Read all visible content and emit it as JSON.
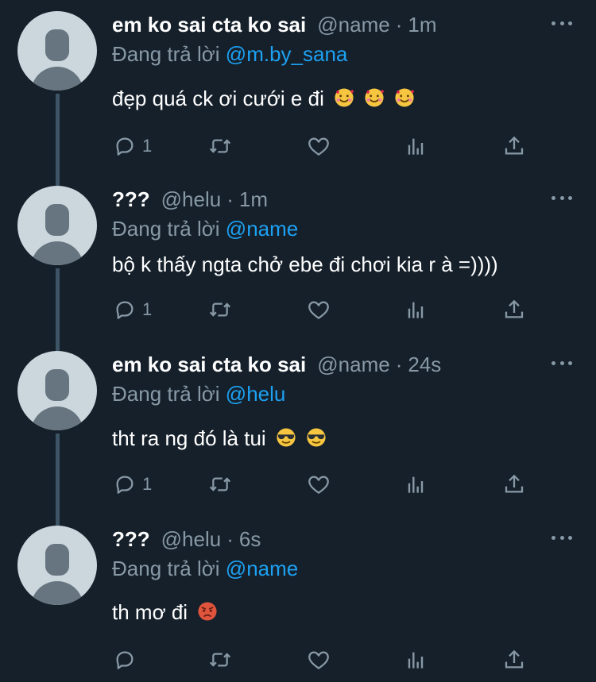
{
  "tweets": [
    {
      "name": "em ko sai cta ko sai",
      "handle": "@name",
      "time": "1m",
      "replying_prefix": "Đang trả lời",
      "replying_to": "@m.by_sana",
      "text": "đẹp quá ck ơi cưới e đi",
      "emojis": [
        "smiling-face-with-hearts",
        "smiling-face-with-hearts",
        "smiling-face-with-hearts"
      ],
      "reply_count": "1"
    },
    {
      "name": "???",
      "handle": "@helu",
      "time": "1m",
      "replying_prefix": "Đang trả lời",
      "replying_to": "@name",
      "text": "bộ k thấy ngta chở ebe đi chơi kia r à =))))",
      "emojis": [],
      "reply_count": "1"
    },
    {
      "name": "em ko sai cta ko sai",
      "handle": "@name",
      "time": "24s",
      "replying_prefix": "Đang trả lời",
      "replying_to": "@helu",
      "text": "tht ra ng đó là tui",
      "emojis": [
        "smiling-face-with-sunglasses",
        "smiling-face-with-sunglasses"
      ],
      "reply_count": "1"
    },
    {
      "name": "???",
      "handle": "@helu",
      "time": "6s",
      "replying_prefix": "Đang trả lời",
      "replying_to": "@name",
      "text": "th mơ đi",
      "emojis": [
        "angry-face"
      ],
      "reply_count": ""
    }
  ],
  "colors": {
    "background": "#15202b",
    "secondary_text": "#8899a6",
    "mention": "#1da1f2",
    "thread_line": "#3d5466"
  }
}
